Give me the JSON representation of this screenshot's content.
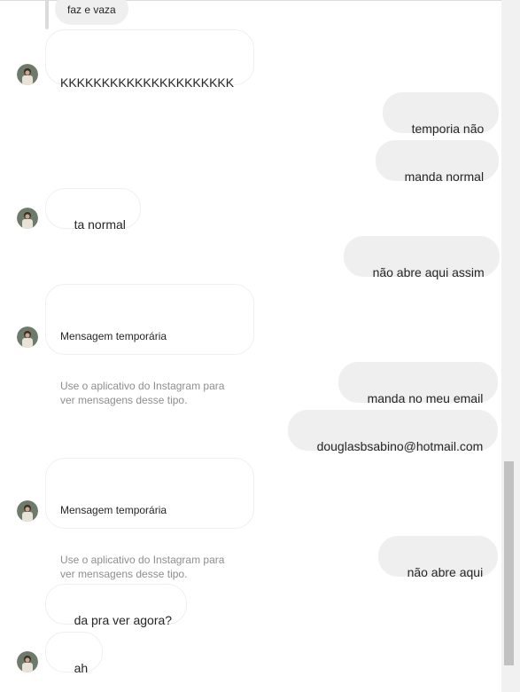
{
  "reply_preview": "faz e vaza",
  "messages": [
    {
      "from": "them",
      "text": "KKKKKKKKKKKKKKKKKKKKK"
    },
    {
      "from": "me",
      "text": "temporia não"
    },
    {
      "from": "me",
      "text": "manda normal"
    },
    {
      "from": "them",
      "text": "ta normal"
    },
    {
      "from": "me",
      "text": "não abre aqui assim"
    },
    {
      "from": "them",
      "temp_title": "Mensagem temporária",
      "temp_sub": "Use o aplicativo do Instagram para ver mensagens desse tipo."
    },
    {
      "from": "me",
      "text": "manda no meu email"
    },
    {
      "from": "me",
      "text": "douglasbsabino@hotmail.com"
    },
    {
      "from": "them",
      "temp_title": "Mensagem temporária",
      "temp_sub": "Use o aplicativo do Instagram para ver mensagens desse tipo."
    },
    {
      "from": "me",
      "text": "não abre aqui"
    },
    {
      "from": "them",
      "text": "da pra ver agora?"
    },
    {
      "from": "them",
      "text": "ah"
    }
  ]
}
